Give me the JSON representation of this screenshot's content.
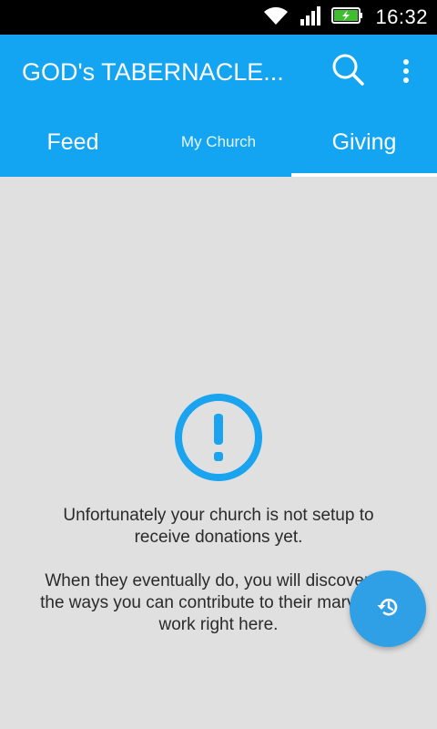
{
  "status_bar": {
    "time": "16:32",
    "icons": [
      "wifi-icon",
      "signal-icon",
      "battery-charging-icon"
    ]
  },
  "app_bar": {
    "title": "GOD's TABERNACLE...",
    "actions": [
      "search-icon",
      "more-vert-icon"
    ],
    "color": "#13a4f2"
  },
  "tabs": [
    {
      "label": "Feed",
      "active": false
    },
    {
      "label": "My Church",
      "active": false
    },
    {
      "label": "Giving",
      "active": true
    }
  ],
  "empty_state": {
    "icon": "alert-circle-icon",
    "line1": "Unfortunately your church is not setup to receive donations yet.",
    "line2": "When they eventually do, you will discover all the ways you can contribute to their marvelous work right here."
  },
  "fab": {
    "icon": "history-icon",
    "color": "#2fa0e6"
  }
}
